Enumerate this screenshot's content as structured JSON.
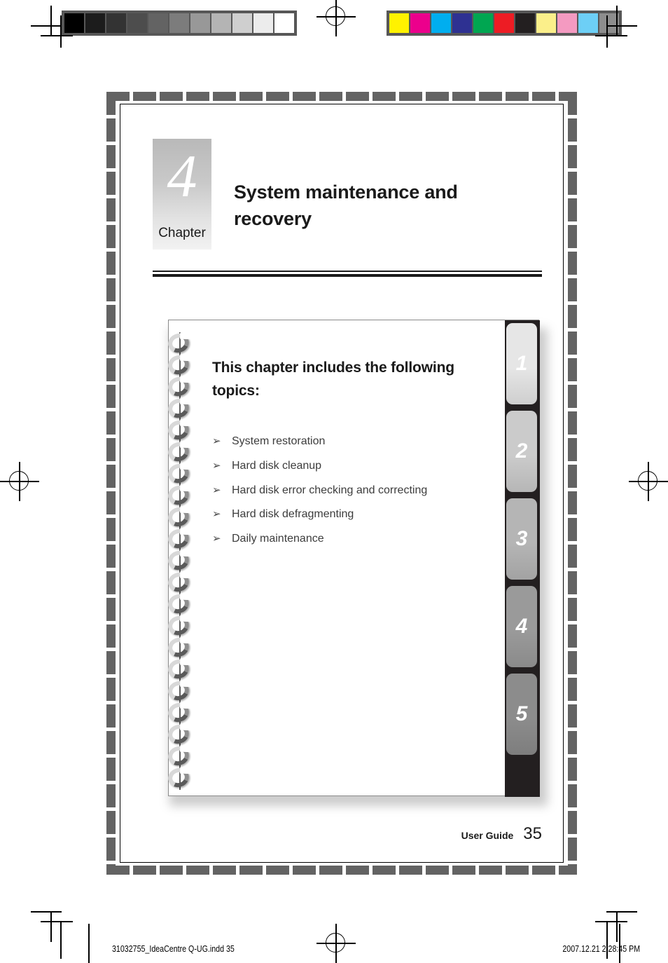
{
  "print_marks": {
    "gray_bar_name": "grayscale-calibration-bar",
    "gray_swatches": [
      "#000000",
      "#1c1c1c",
      "#333333",
      "#4d4d4d",
      "#636363",
      "#7c7c7c",
      "#989898",
      "#b4b4b4",
      "#cfcfcf",
      "#ececec",
      "#ffffff"
    ],
    "color_bar_name": "color-calibration-bar",
    "color_swatches": [
      "#fff200",
      "#ec008c",
      "#00aeef",
      "#2e3192",
      "#00a651",
      "#ed1c24",
      "#231f20",
      "#fbef8a",
      "#f49ac1",
      "#6dcff6",
      "#8d8d8d"
    ]
  },
  "chapter": {
    "number": "4",
    "word": "Chapter",
    "title": "System maintenance and recovery"
  },
  "card": {
    "heading": "This chapter includes the following topics:",
    "topics": [
      "System restoration",
      "Hard disk cleanup",
      "Hard disk error checking and correcting",
      "Hard disk defragmenting",
      "Daily maintenance"
    ],
    "bullet_glyph": "➢",
    "tabs": [
      {
        "label": "1",
        "color": "#e6e6e6"
      },
      {
        "label": "2",
        "color": "#cbcbcb"
      },
      {
        "label": "3",
        "color": "#b5b5b5"
      },
      {
        "label": "4",
        "color": "#9a9a9a"
      },
      {
        "label": "5",
        "color": "#8c8c8c"
      }
    ]
  },
  "footer": {
    "label": "User Guide",
    "page_number": "35"
  },
  "slug": {
    "file": "31032755_IdeaCentre Q-UG.indd   35",
    "timestamp": "2007.12.21   2:28:45 PM"
  }
}
